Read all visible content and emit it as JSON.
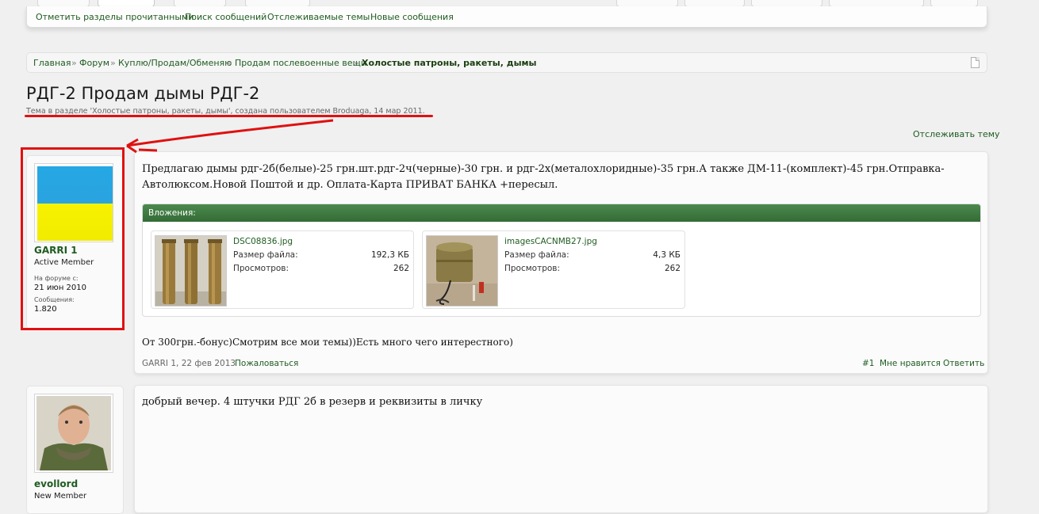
{
  "navbar": {
    "links": [
      "Отметить разделы прочитанными",
      "Поиск сообщений",
      "Отслеживаемые темы",
      "Новые сообщения"
    ]
  },
  "breadcrumb": {
    "items": [
      "Главная",
      "Форум",
      "Куплю/Продам/Обменяю",
      "Продам послевоенные вещи",
      "Холостые патроны, ракеты, дымы"
    ],
    "separator": "»"
  },
  "thread": {
    "title": "РДГ-2 Продам дымы РДГ-2",
    "subtitle": "Тема в разделе 'Холостые патроны, ракеты, дымы', создана пользователем Broduaga, 14 мар 2011.",
    "watch_label": "Отслеживать тему"
  },
  "posts": [
    {
      "user": {
        "name": "GARRI 1",
        "title": "Active Member",
        "since_label": "На форуме с:",
        "since": "21 июн 2010",
        "posts_label": "Сообщения:",
        "posts": "1.820"
      },
      "text_lines": [
        "Предлагаю дымы рдг-2б(белые)-25 грн.шт.рдг-2ч(черные)-30 грн. и рдг-2х(металохлоридные)-35 грн.А также ДМ-11-(комплект)-45 грн.Отправка-",
        "Автолюксом.Новой Поштой и др. Оплата-Карта ПРИВАТ БАНКА +пересыл."
      ],
      "attachments_label": "Вложения:",
      "attachments": [
        {
          "filename": "DSC08836.jpg",
          "size_label": "Размер файла:",
          "size": "192,3 КБ",
          "views_label": "Просмотров:",
          "views": "262"
        },
        {
          "filename": "imagesCACNMB27.jpg",
          "size_label": "Размер файла:",
          "size": "4,3 КБ",
          "views_label": "Просмотров:",
          "views": "262"
        }
      ],
      "extra_text": "От 300грн.-бонус)Смотрим все мои темы))Есть много чего интерестного)",
      "footer": {
        "author_date": "GARRI 1, 22 фев 2013",
        "report": "Пожаловаться",
        "number": "#1",
        "like": "Мне нравится",
        "reply": "Ответить"
      }
    },
    {
      "user": {
        "name": "evollord",
        "title": "New Member"
      },
      "text": "добрый вечер. 4 штучки РДГ 2б в резерв и реквизиты в личку"
    }
  ],
  "colors": {
    "link_green": "#1f5c20",
    "attach_header": "#3d7a3f",
    "annotation_red": "#e01010"
  }
}
